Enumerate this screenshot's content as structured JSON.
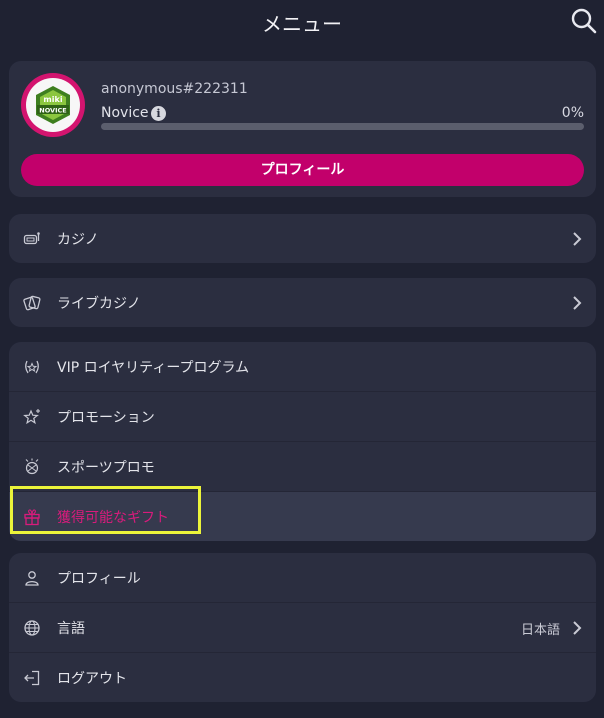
{
  "header": {
    "title": "メニュー"
  },
  "profile": {
    "badge": {
      "brand": "miki",
      "level_text": "NOVICE"
    },
    "username": "anonymous#222311",
    "level": "Novice",
    "progress_label": "0%",
    "progress_fraction": 0,
    "profile_button": "プロフィール"
  },
  "menu": {
    "casino": {
      "label": "カジノ"
    },
    "live_casino": {
      "label": "ライブカジノ"
    },
    "group1": [
      {
        "label": "VIP ロイヤリティープログラム"
      },
      {
        "label": "プロモーション"
      },
      {
        "label": "スポーツプロモ"
      },
      {
        "label": "獲得可能なギフト"
      }
    ],
    "group2": [
      {
        "label": "プロフィール"
      },
      {
        "label": "言語",
        "value": "日本語"
      },
      {
        "label": "ログアウト"
      }
    ]
  },
  "colors": {
    "accent": "#c2006b",
    "background": "#1f2232",
    "card": "#2b2e40",
    "highlight_border": "#ecf43a"
  }
}
